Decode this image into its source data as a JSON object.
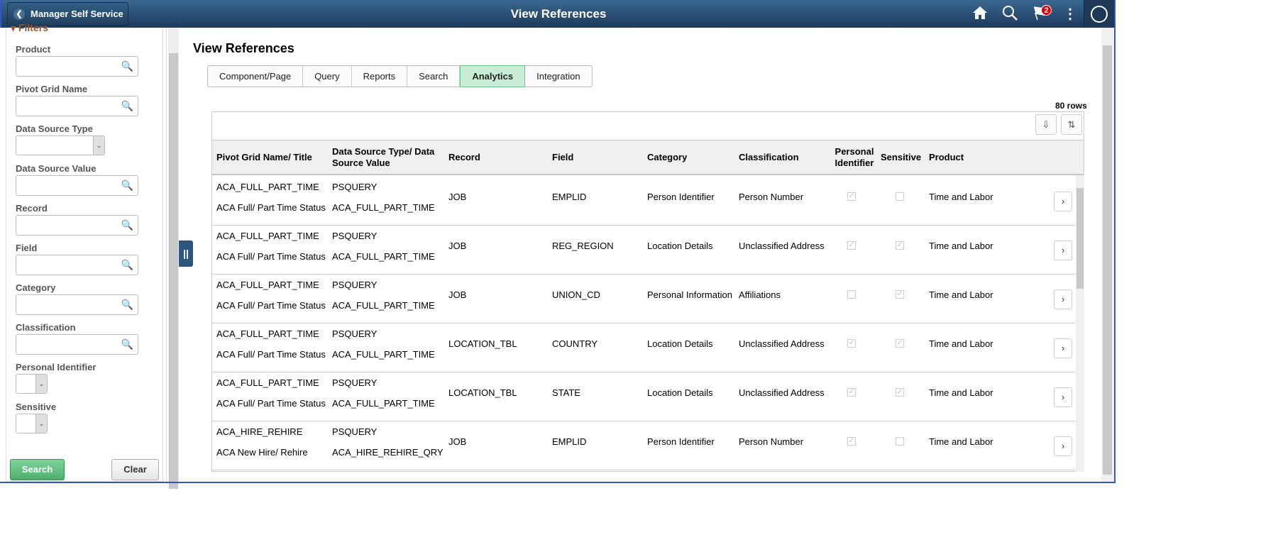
{
  "header": {
    "back_label": "Manager Self Service",
    "title": "View References",
    "notification_count": "2",
    "icons": [
      "home-icon",
      "search-icon",
      "flag-icon",
      "more-vert-icon",
      "navbar-compass-icon"
    ]
  },
  "filters": {
    "heading": "Filters",
    "fields": [
      {
        "label": "Product",
        "type": "lookup",
        "value": ""
      },
      {
        "label": "Pivot Grid Name",
        "type": "lookup",
        "value": ""
      },
      {
        "label": "Data Source Type",
        "type": "select",
        "value": ""
      },
      {
        "label": "Data Source Value",
        "type": "lookup",
        "value": ""
      },
      {
        "label": "Record",
        "type": "lookup",
        "value": ""
      },
      {
        "label": "Field",
        "type": "lookup",
        "value": ""
      },
      {
        "label": "Category",
        "type": "lookup",
        "value": ""
      },
      {
        "label": "Classification",
        "type": "lookup",
        "value": ""
      },
      {
        "label": "Personal Identifier",
        "type": "select",
        "value": ""
      },
      {
        "label": "Sensitive",
        "type": "select",
        "value": ""
      }
    ],
    "search_label": "Search",
    "clear_label": "Clear"
  },
  "main": {
    "title": "View References",
    "tabs": [
      {
        "label": "Component/Page"
      },
      {
        "label": "Query"
      },
      {
        "label": "Reports"
      },
      {
        "label": "Search"
      },
      {
        "label": "Analytics",
        "active": true
      },
      {
        "label": "Integration"
      }
    ],
    "row_count": "80 rows",
    "columns": [
      "Pivot Grid Name/ Title",
      "Data Source Type/ Data Source Value",
      "Record",
      "Field",
      "Category",
      "Classification",
      "Personal Identifier",
      "Sensitive",
      "Product"
    ],
    "rows": [
      {
        "name": "ACA_FULL_PART_TIME",
        "title": "ACA Full/ Part Time Status",
        "ds_type": "PSQUERY",
        "ds_value": "ACA_FULL_PART_TIME",
        "record": "JOB",
        "field": "EMPLID",
        "category": "Person Identifier",
        "classification": "Person Number",
        "personal_identifier": true,
        "sensitive": false,
        "product": "Time and Labor"
      },
      {
        "name": "ACA_FULL_PART_TIME",
        "title": "ACA Full/ Part Time Status",
        "ds_type": "PSQUERY",
        "ds_value": "ACA_FULL_PART_TIME",
        "record": "JOB",
        "field": "REG_REGION",
        "category": "Location Details",
        "classification": "Unclassified Address",
        "personal_identifier": true,
        "sensitive": true,
        "product": "Time and Labor"
      },
      {
        "name": "ACA_FULL_PART_TIME",
        "title": "ACA Full/ Part Time Status",
        "ds_type": "PSQUERY",
        "ds_value": "ACA_FULL_PART_TIME",
        "record": "JOB",
        "field": "UNION_CD",
        "category": "Personal Information",
        "classification": "Affiliations",
        "personal_identifier": false,
        "sensitive": true,
        "product": "Time and Labor"
      },
      {
        "name": "ACA_FULL_PART_TIME",
        "title": "ACA Full/ Part Time Status",
        "ds_type": "PSQUERY",
        "ds_value": "ACA_FULL_PART_TIME",
        "record": "LOCATION_TBL",
        "field": "COUNTRY",
        "category": "Location Details",
        "classification": "Unclassified Address",
        "personal_identifier": true,
        "sensitive": true,
        "product": "Time and Labor"
      },
      {
        "name": "ACA_FULL_PART_TIME",
        "title": "ACA Full/ Part Time Status",
        "ds_type": "PSQUERY",
        "ds_value": "ACA_FULL_PART_TIME",
        "record": "LOCATION_TBL",
        "field": "STATE",
        "category": "Location Details",
        "classification": "Unclassified Address",
        "personal_identifier": true,
        "sensitive": true,
        "product": "Time and Labor"
      },
      {
        "name": "ACA_HIRE_REHIRE",
        "title": "ACA New Hire/ Rehire",
        "ds_type": "PSQUERY",
        "ds_value": "ACA_HIRE_REHIRE_QRY",
        "record": "JOB",
        "field": "EMPLID",
        "category": "Person Identifier",
        "classification": "Person Number",
        "personal_identifier": true,
        "sensitive": false,
        "product": "Time and Labor"
      }
    ]
  }
}
